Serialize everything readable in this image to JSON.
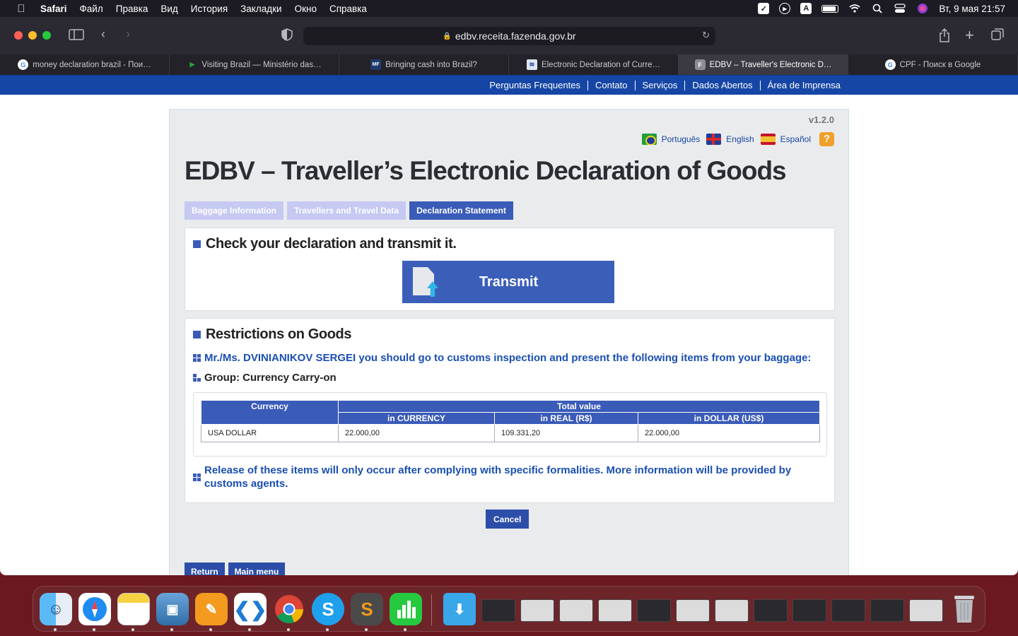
{
  "menubar": {
    "app": "Safari",
    "items": [
      "Файл",
      "Правка",
      "Вид",
      "История",
      "Закладки",
      "Окно",
      "Справка"
    ],
    "datetime": "Вт, 9 мая  21:57",
    "input_source": "A"
  },
  "browser": {
    "url": "edbv.receita.fazenda.gov.br",
    "tabs": [
      {
        "title": "money declaration brazil - Пои…",
        "icon": "google-icon"
      },
      {
        "title": "Visiting Brazil — Ministério das…",
        "icon": "gov-br-icon"
      },
      {
        "title": "Bringing cash into Brazil?",
        "icon": "mf-icon"
      },
      {
        "title": "Electronic Declaration of Curre…",
        "icon": "receita-icon"
      },
      {
        "title": "EDBV – Traveller's Electronic D…",
        "icon": "f-icon",
        "active": true
      },
      {
        "title": "CPF - Поиск в Google",
        "icon": "google-icon"
      }
    ]
  },
  "govbar": {
    "links": [
      "Perguntas Frequentes",
      "Contato",
      "Serviços",
      "Dados Abertos",
      "Área de Imprensa"
    ]
  },
  "page": {
    "version": "v1.2.0",
    "languages": [
      "Português",
      "English",
      "Español"
    ],
    "help": "?",
    "title": "EDBV – Traveller’s Electronic Declaration of Goods",
    "steps": [
      "Baggage Information",
      "Travellers and Travel Data",
      "Declaration Statement"
    ],
    "active_step": 2,
    "check_heading": "Check your declaration and transmit it.",
    "transmit_label": "Transmit",
    "restrictions_heading": "Restrictions on Goods",
    "inspection_msg": "Mr./Ms. DVINIANIKOV SERGEI you should go to customs inspection and present the following items from your baggage:",
    "group_label": "Group: Currency Carry-on",
    "table": {
      "col_currency": "Currency",
      "col_total": "Total value",
      "sub_currency": "in CURRENCY",
      "sub_real": "in REAL (R$)",
      "sub_dollar": "in DOLLAR (US$)",
      "rows": [
        {
          "currency": "USA DOLLAR",
          "in_currency": "22.000,00",
          "in_real": "109.331,20",
          "in_dollar": "22.000,00"
        }
      ]
    },
    "release_msg": "Release of these items will only occur after complying with specific formalities. More information will be provided by customs agents.",
    "cancel_label": "Cancel",
    "return_label": "Return",
    "main_menu_label": "Main menu"
  },
  "colors": {
    "gov_blue": "#1646a5",
    "accent": "#3a5bb8",
    "inactive_step": "#c6c9f2",
    "link_blue": "#1a4fb0"
  }
}
